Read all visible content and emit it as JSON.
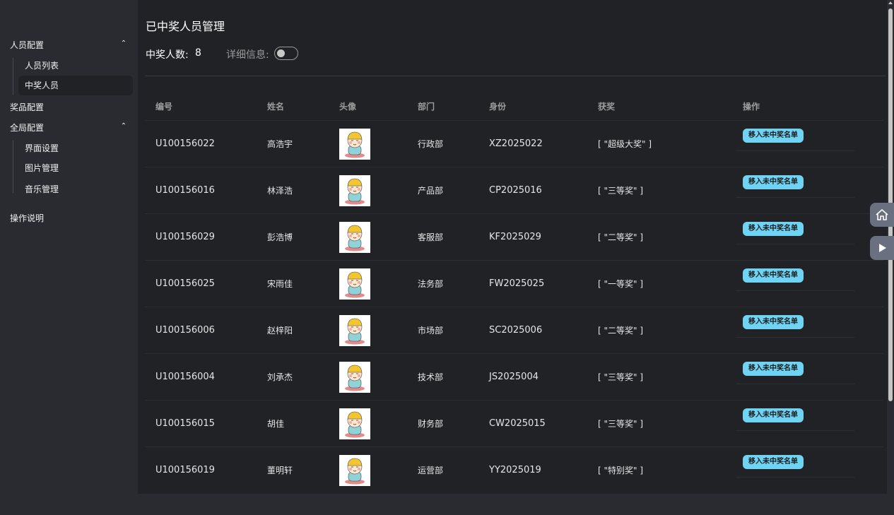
{
  "sidebar": {
    "groups": [
      {
        "label": "人员配置",
        "children": [
          {
            "label": "人员列表"
          },
          {
            "label": "中奖人员"
          }
        ]
      },
      {
        "label": "奖品配置"
      },
      {
        "label": "全局配置",
        "children": [
          {
            "label": "界面设置"
          },
          {
            "label": "图片管理"
          },
          {
            "label": "音乐管理"
          }
        ]
      },
      {
        "label": "操作说明"
      }
    ],
    "active": "中奖人员"
  },
  "header": {
    "title": "已中奖人员管理",
    "count_label": "中奖人数:",
    "count": "8",
    "detail_label": "详细信息:",
    "detail_enabled": false
  },
  "table": {
    "columns": [
      "编号",
      "姓名",
      "头像",
      "部门",
      "身份",
      "获奖",
      "操作"
    ],
    "rows": [
      {
        "id": "U100156022",
        "name": "高浩宇",
        "dept": "行政部",
        "identity": "XZ2025022",
        "prize": "[ \"超级大奖\" ]",
        "action": "移入未中奖名单"
      },
      {
        "id": "U100156016",
        "name": "林泽浩",
        "dept": "产品部",
        "identity": "CP2025016",
        "prize": "[ \"三等奖\" ]",
        "action": "移入未中奖名单"
      },
      {
        "id": "U100156029",
        "name": "彭浩博",
        "dept": "客服部",
        "identity": "KF2025029",
        "prize": "[ \"二等奖\" ]",
        "action": "移入未中奖名单"
      },
      {
        "id": "U100156025",
        "name": "宋雨佳",
        "dept": "法务部",
        "identity": "FW2025025",
        "prize": "[ \"一等奖\" ]",
        "action": "移入未中奖名单"
      },
      {
        "id": "U100156006",
        "name": "赵梓阳",
        "dept": "市场部",
        "identity": "SC2025006",
        "prize": "[ \"二等奖\" ]",
        "action": "移入未中奖名单"
      },
      {
        "id": "U100156004",
        "name": "刘承杰",
        "dept": "技术部",
        "identity": "JS2025004",
        "prize": "[ \"三等奖\" ]",
        "action": "移入未中奖名单"
      },
      {
        "id": "U100156015",
        "name": "胡佳",
        "dept": "财务部",
        "identity": "CW2025015",
        "prize": "[ \"三等奖\" ]",
        "action": "移入未中奖名单"
      },
      {
        "id": "U100156019",
        "name": "董明轩",
        "dept": "运营部",
        "identity": "YY2025019",
        "prize": "[ \"特别奖\" ]",
        "action": "移入未中奖名单"
      }
    ]
  },
  "floating": {
    "icons": [
      "home-icon",
      "play-icon"
    ]
  },
  "colors": {
    "accent": "#6fd3f3",
    "background": "#212226",
    "sidebar": "#2a2b30"
  }
}
